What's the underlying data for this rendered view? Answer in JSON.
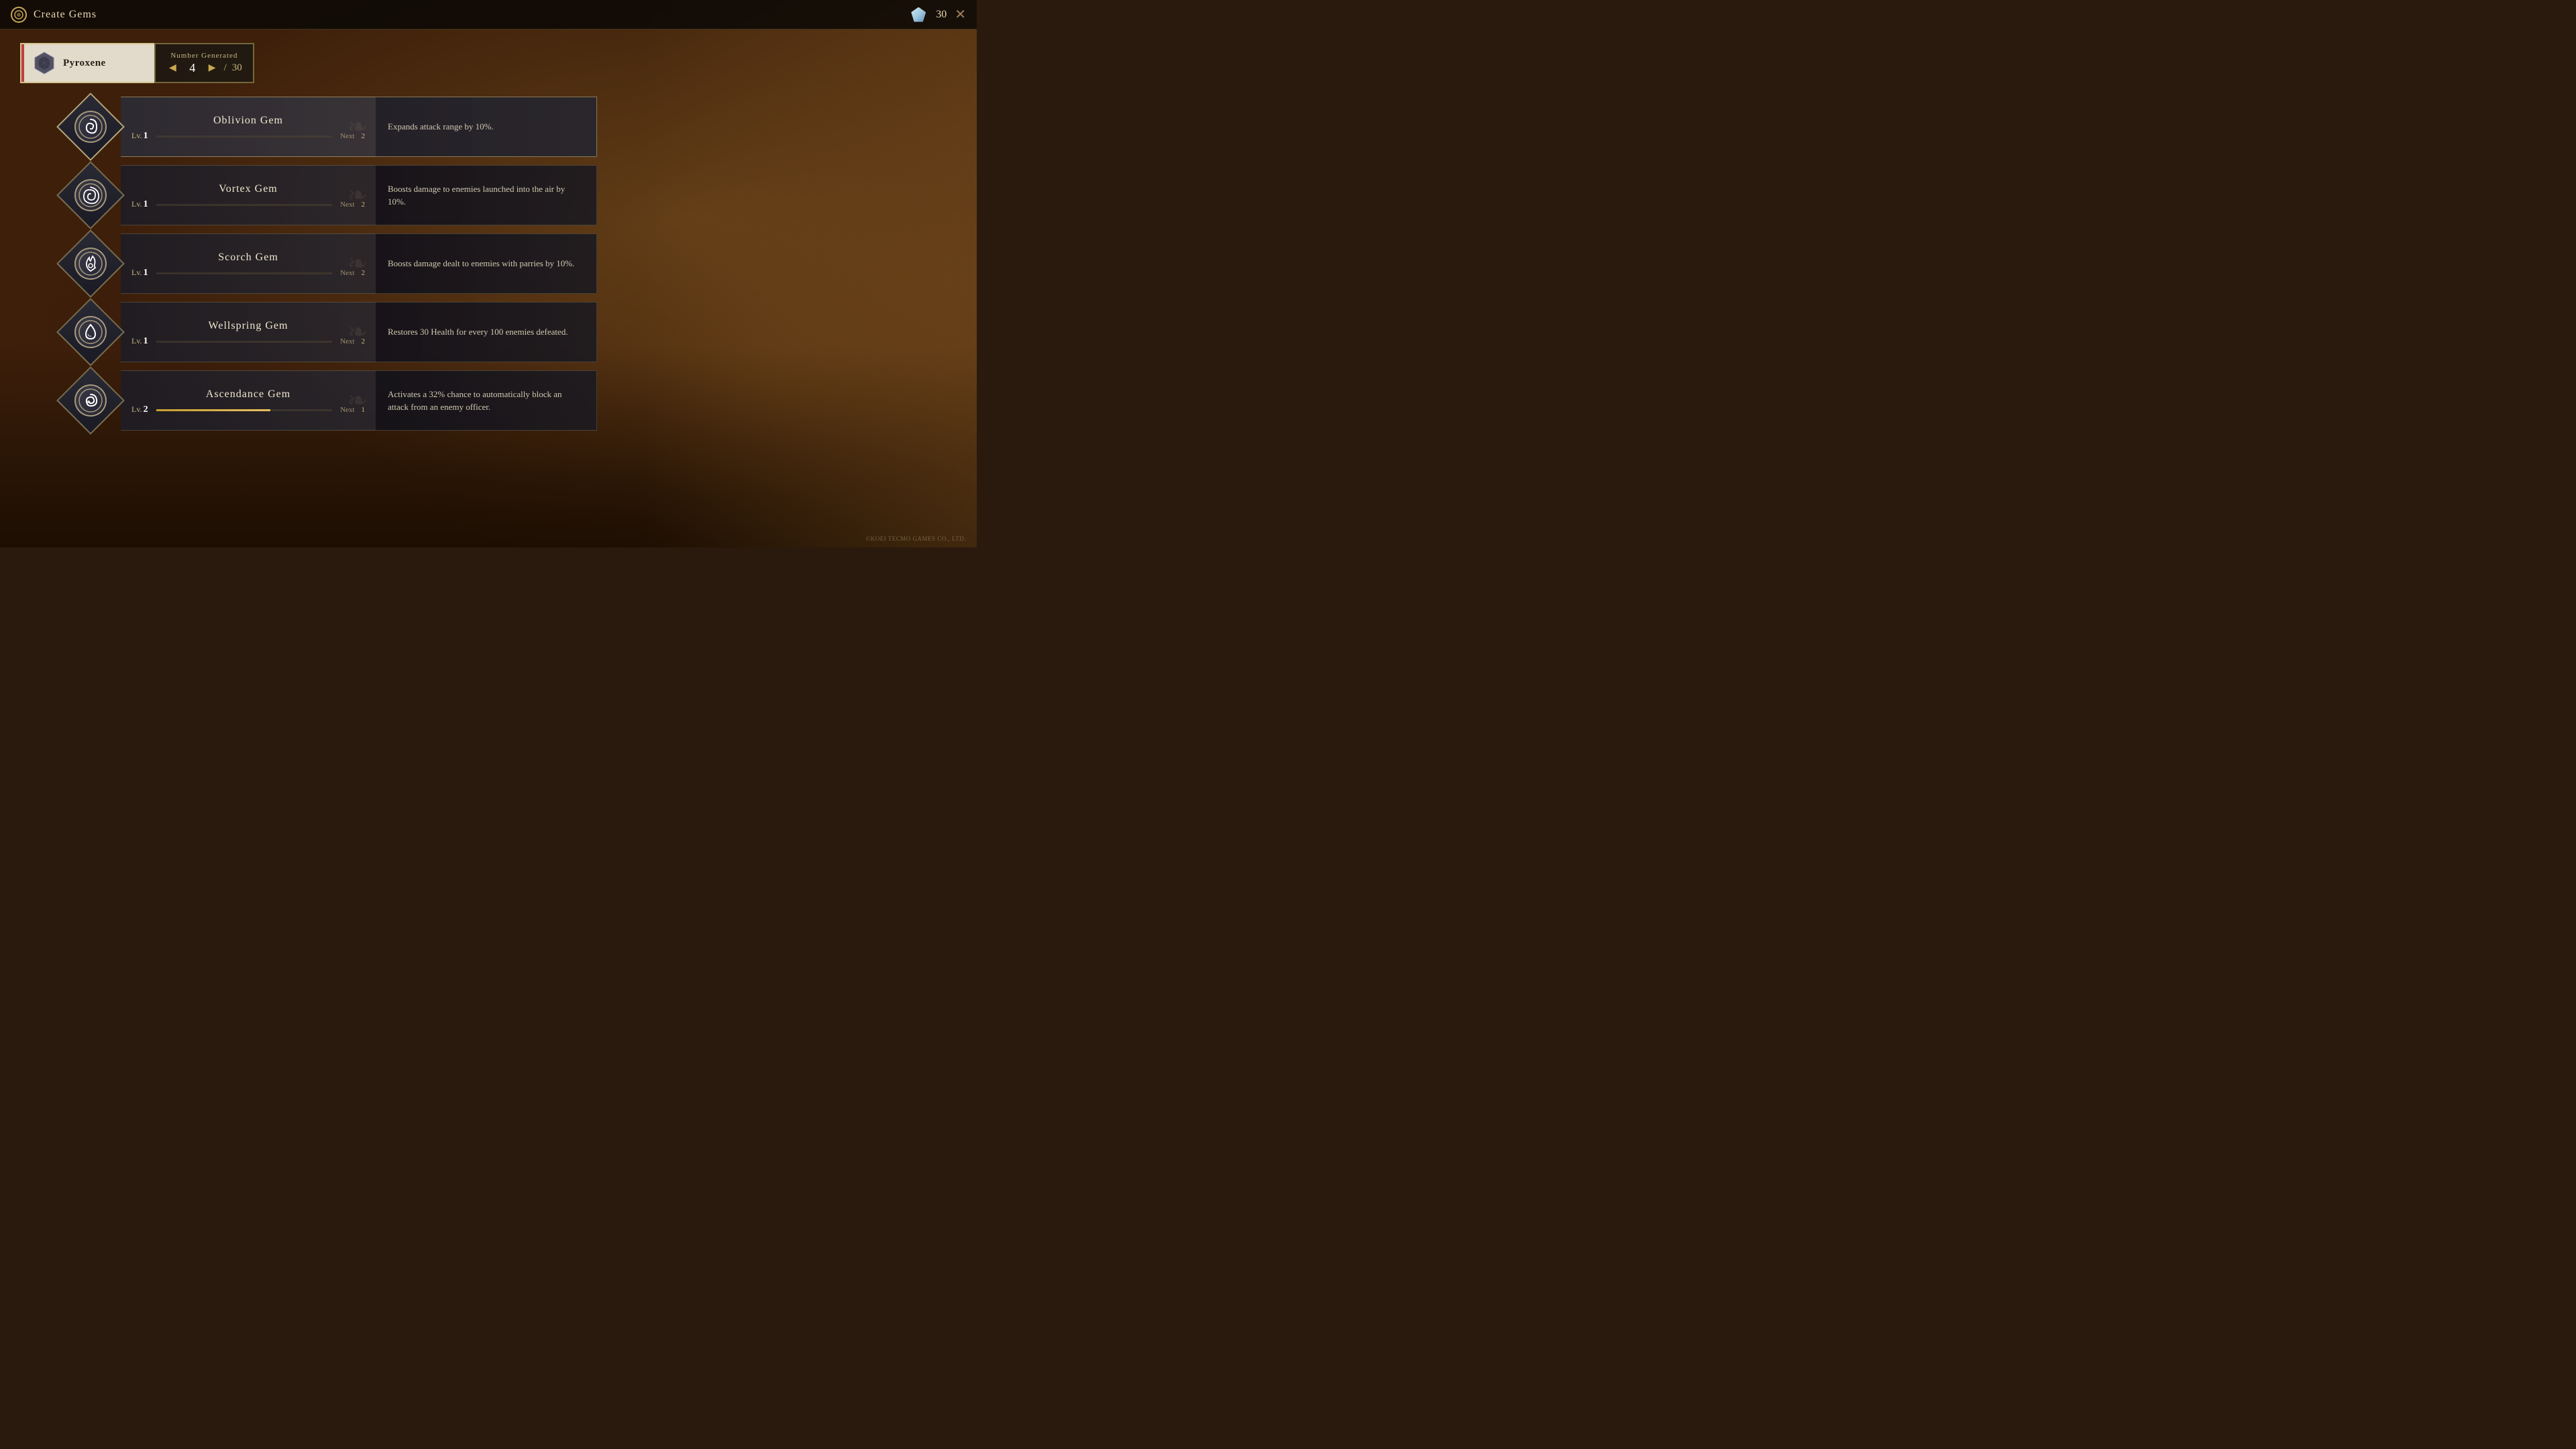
{
  "header": {
    "title": "Create Gems",
    "icon_label": "◆",
    "crystal_count": "30",
    "close_label": "✕"
  },
  "material": {
    "name": "Pyroxene",
    "icon_alt": "gem-material-icon"
  },
  "number_generated": {
    "label": "Number Generated",
    "value": "4",
    "total": "30"
  },
  "gems": [
    {
      "name": "Oblivion Gem",
      "icon_symbol": "spiral",
      "level": "1",
      "next_label": "Next",
      "next_value": "2",
      "progress": 0,
      "description": "Expands attack range by 10%.",
      "selected": true
    },
    {
      "name": "Vortex Gem",
      "icon_symbol": "vortex",
      "level": "1",
      "next_label": "Next",
      "next_value": "2",
      "progress": 0,
      "description": "Boosts damage to enemies launched into the air by 10%.",
      "selected": false
    },
    {
      "name": "Scorch Gem",
      "icon_symbol": "flame",
      "level": "1",
      "next_label": "Next",
      "next_value": "2",
      "progress": 0,
      "description": "Boosts damage dealt to enemies with parries by 10%.",
      "selected": false
    },
    {
      "name": "Wellspring Gem",
      "icon_symbol": "drop",
      "level": "1",
      "next_label": "Next",
      "next_value": "2",
      "progress": 0,
      "description": "Restores 30 Health for every 100 enemies defeated.",
      "selected": false
    },
    {
      "name": "Ascendance Gem",
      "icon_symbol": "swirl",
      "level": "2",
      "next_label": "Next",
      "next_value": "1",
      "progress": 65,
      "description": "Activates a 32% chance to automatically block an attack from an enemy officer.",
      "selected": false
    }
  ],
  "copyright": "©KOEI TECMO GAMES CO., LTD."
}
